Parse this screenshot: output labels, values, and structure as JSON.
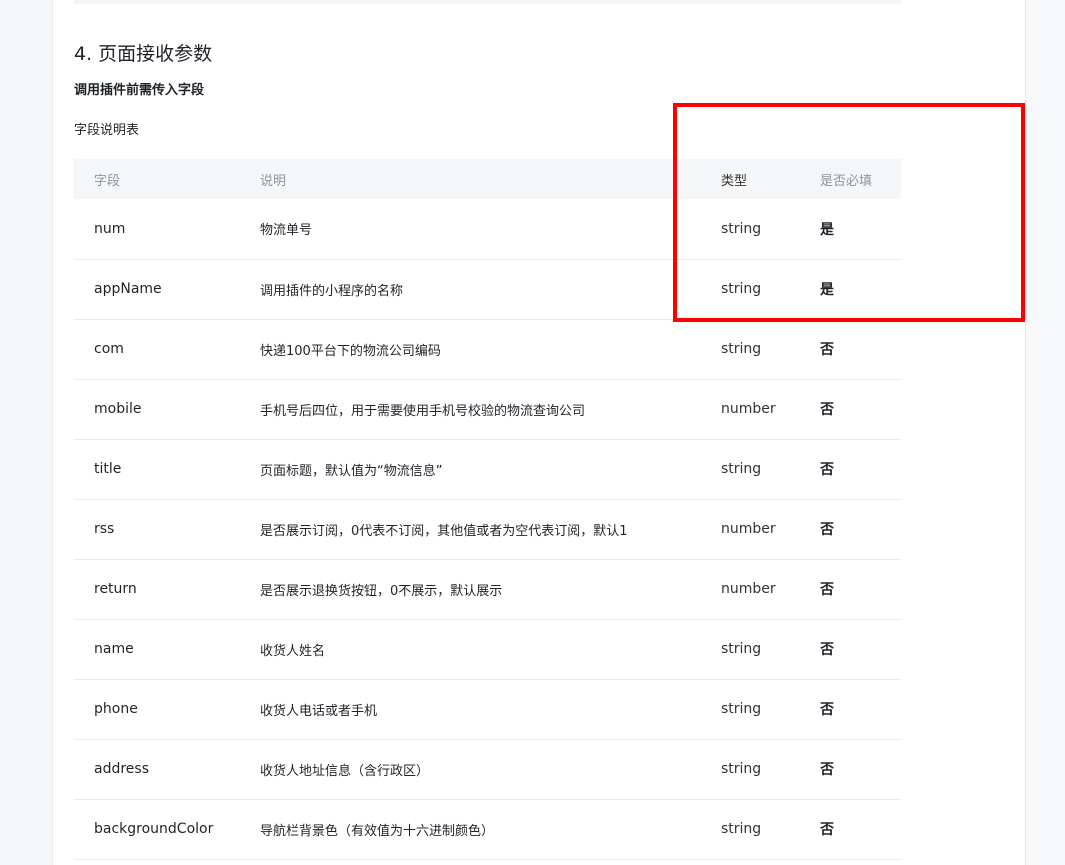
{
  "section": {
    "title": "4. 页面接收参数",
    "subheading": "调用插件前需传入字段",
    "caption": "字段说明表"
  },
  "table": {
    "headers": {
      "field": "字段",
      "description": "说明",
      "type": "类型",
      "required": "是否必填"
    },
    "rows": [
      {
        "field": "num",
        "description": "物流单号",
        "type": "string",
        "required": "是"
      },
      {
        "field": "appName",
        "description": "调用插件的小程序的名称",
        "type": "string",
        "required": "是"
      },
      {
        "field": "com",
        "description": "快递100平台下的物流公司编码",
        "type": "string",
        "required": "否"
      },
      {
        "field": "mobile",
        "description": "手机号后四位，用于需要使用手机号校验的物流查询公司",
        "type": "number",
        "required": "否"
      },
      {
        "field": "title",
        "description": "页面标题，默认值为“物流信息”",
        "type": "string",
        "required": "否"
      },
      {
        "field": "rss",
        "description": "是否展示订阅，0代表不订阅，其他值或者为空代表订阅，默认1",
        "type": "number",
        "required": "否"
      },
      {
        "field": "return",
        "description": "是否展示退换货按钮，0不展示，默认展示",
        "type": "number",
        "required": "否"
      },
      {
        "field": "name",
        "description": "收货人姓名",
        "type": "string",
        "required": "否"
      },
      {
        "field": "phone",
        "description": "收货人电话或者手机",
        "type": "string",
        "required": "否"
      },
      {
        "field": "address",
        "description": "收货人地址信息（含行政区）",
        "type": "string",
        "required": "否"
      },
      {
        "field": "backgroundColor",
        "description": "导航栏背景色（有效值为十六进制颜色）",
        "type": "string",
        "required": "否"
      }
    ]
  },
  "highlight_color": "#ff0000"
}
